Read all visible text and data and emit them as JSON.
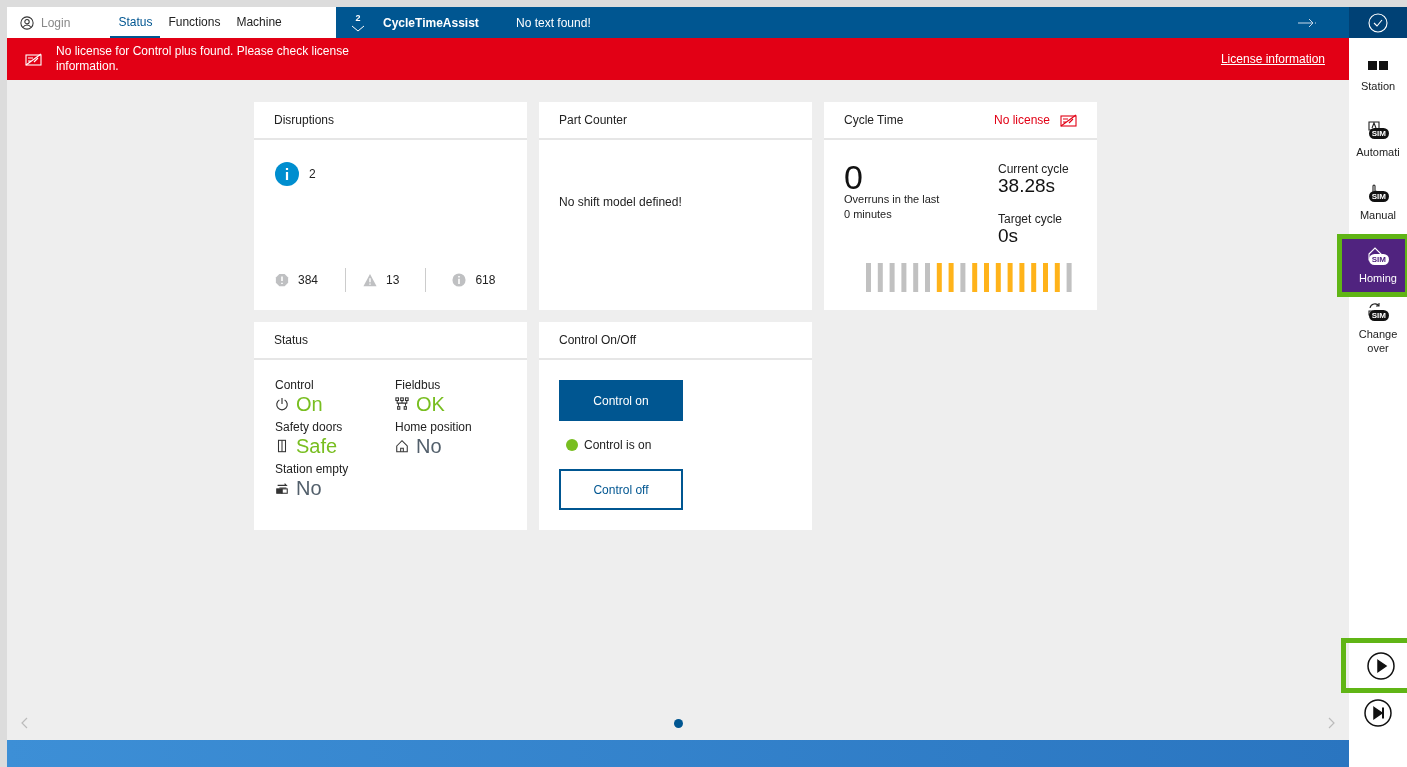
{
  "top_bar": {
    "login": "Login",
    "tabs": [
      {
        "label": "Status",
        "selected": true
      },
      {
        "label": "Functions",
        "selected": false
      },
      {
        "label": "Machine",
        "selected": false
      }
    ],
    "message_count": "2",
    "app_name": "CycleTimeAssist",
    "message": "No text found!"
  },
  "banner": {
    "text": "No license for Control plus found. Please check license information.",
    "link": "License information"
  },
  "disruptions": {
    "title": "Disruptions",
    "active_count": "2",
    "counters": [
      {
        "kind": "error",
        "value": "384"
      },
      {
        "kind": "warning",
        "value": "13"
      },
      {
        "kind": "info",
        "value": "618"
      }
    ]
  },
  "part_counter": {
    "title": "Part Counter",
    "message": "No shift model defined!"
  },
  "cycle_time": {
    "title": "Cycle Time",
    "license": "No license",
    "overruns": "0",
    "overruns_label": "Overruns in the last 0 minutes",
    "current_label": "Current cycle",
    "current": "38.28s",
    "target_label": "Target cycle",
    "target": "0s",
    "bars": [
      {
        "color": "#c1c1c1"
      },
      {
        "color": "#c1c1c1"
      },
      {
        "color": "#c1c1c1"
      },
      {
        "color": "#c1c1c1"
      },
      {
        "color": "#c1c1c1"
      },
      {
        "color": "#c1c1c1"
      },
      {
        "color": "#ffb31a"
      },
      {
        "color": "#ffb31a"
      },
      {
        "color": "#c1c1c1"
      },
      {
        "color": "#ffb31a"
      },
      {
        "color": "#ffb31a"
      },
      {
        "color": "#ffb31a"
      },
      {
        "color": "#ffb31a"
      },
      {
        "color": "#ffb31a"
      },
      {
        "color": "#ffb31a"
      },
      {
        "color": "#ffb31a"
      },
      {
        "color": "#ffb31a"
      },
      {
        "color": "#c1c1c1"
      }
    ]
  },
  "status": {
    "title": "Status",
    "items": [
      {
        "kind": "power",
        "label": "Control",
        "value": "On",
        "ok": true
      },
      {
        "kind": "fieldbus",
        "label": "Fieldbus",
        "value": "OK",
        "ok": true
      },
      {
        "kind": "door",
        "label": "Safety doors",
        "value": "Safe",
        "ok": true
      },
      {
        "kind": "home",
        "label": "Home position",
        "value": "No",
        "ok": false
      },
      {
        "kind": "station",
        "label": "Station empty",
        "value": "No",
        "ok": false
      }
    ]
  },
  "control": {
    "title": "Control On/Off",
    "on_button": "Control on",
    "state": "Control is on",
    "on": true,
    "off_button": "Control off"
  },
  "sidebar": {
    "items": [
      {
        "kind": "station",
        "label": "Station",
        "selected": false
      },
      {
        "kind": "automatic",
        "label": "Automati",
        "badge": "SIM",
        "selected": false
      },
      {
        "kind": "manual",
        "label": "Manual",
        "badge": "SIM",
        "selected": false
      },
      {
        "kind": "homing",
        "label": "Homing",
        "badge": "SIM",
        "selected": true
      },
      {
        "kind": "changeover",
        "label": "Change over",
        "badge": "SIM",
        "selected": false
      }
    ]
  },
  "pager": {
    "pages": [
      {
        "selected": true
      }
    ]
  }
}
